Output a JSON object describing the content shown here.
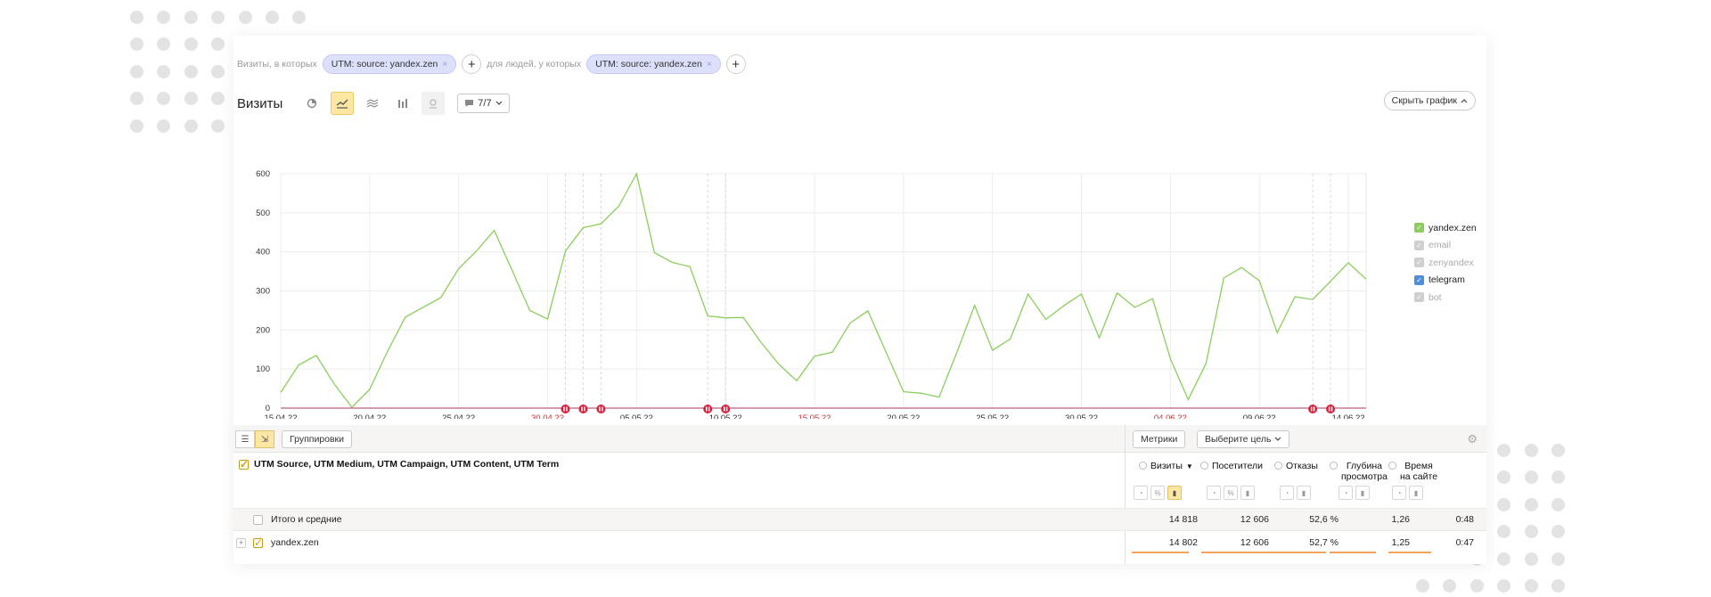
{
  "filters": {
    "visits_prefix": "Визиты, в которых",
    "visits_chip": "UTM: source: yandex.zen",
    "people_prefix": "для людей, у которых",
    "people_chip": "UTM: source: yandex.zen",
    "chip_close": "×",
    "add": "+"
  },
  "toolbar": {
    "title": "Визиты",
    "annotations_label": "7/7",
    "hide_graph": "Скрыть график"
  },
  "chart_data": {
    "type": "line",
    "ylim": [
      0,
      600
    ],
    "yticks": [
      "0",
      "100",
      "200",
      "300",
      "400",
      "500",
      "600"
    ],
    "xtick_labels": [
      {
        "label": "15.04.22",
        "weekend": false
      },
      {
        "label": "20.04.22",
        "weekend": false
      },
      {
        "label": "25.04.22",
        "weekend": false
      },
      {
        "label": "30.04.22",
        "weekend": true
      },
      {
        "label": "05.05.22",
        "weekend": false
      },
      {
        "label": "10.05.22",
        "weekend": false
      },
      {
        "label": "15.05.22",
        "weekend": true
      },
      {
        "label": "20.05.22",
        "weekend": false
      },
      {
        "label": "25.05.22",
        "weekend": false
      },
      {
        "label": "30.05.22",
        "weekend": false
      },
      {
        "label": "04.06.22",
        "weekend": true
      },
      {
        "label": "09.06.22",
        "weekend": false
      },
      {
        "label": "14.06.22",
        "weekend": false
      }
    ],
    "series": [
      {
        "name": "yandex.zen",
        "color": "#8dcd5e",
        "values": [
          40,
          110,
          135,
          62,
          2,
          48,
          145,
          233,
          258,
          283,
          357,
          402,
          455,
          353,
          250,
          228,
          402,
          462,
          472,
          517,
          600,
          398,
          373,
          362,
          236,
          231,
          232,
          168,
          112,
          70,
          133,
          143,
          218,
          249,
          145,
          42,
          38,
          28,
          143,
          263,
          148,
          177,
          292,
          227,
          262,
          292,
          180,
          295,
          258,
          280,
          126,
          22,
          114,
          333,
          360,
          326,
          193,
          285,
          278,
          325,
          372,
          330
        ]
      },
      {
        "name": "telegram",
        "color": "#4d8fdc",
        "values": [
          0,
          0,
          0,
          0,
          0,
          0,
          0,
          0,
          0,
          0,
          0,
          0,
          0,
          0,
          0,
          0,
          0,
          0,
          0,
          0,
          0,
          0,
          0,
          0,
          0,
          0,
          0,
          0,
          0,
          0,
          0,
          0,
          0,
          0,
          0,
          0,
          0,
          0,
          0,
          0,
          0,
          0,
          0,
          0,
          0,
          0,
          0,
          0,
          0,
          0,
          0,
          0,
          0,
          0,
          0,
          0,
          0,
          0,
          0,
          0,
          0,
          0
        ]
      }
    ],
    "annotation_markers": [
      16,
      17,
      18,
      24,
      25,
      58,
      59
    ]
  },
  "legend": [
    {
      "label": "yandex.zen",
      "checked": true,
      "color": "#8dcd5e",
      "text_color": "#222"
    },
    {
      "label": "email",
      "checked": true,
      "color": "#cfcfcf",
      "text_color": "#aaa"
    },
    {
      "label": "zenyandex",
      "checked": true,
      "color": "#cfcfcf",
      "text_color": "#aaa"
    },
    {
      "label": "telegram",
      "checked": true,
      "color": "#4d8fdc",
      "text_color": "#222"
    },
    {
      "label": "bot",
      "checked": true,
      "color": "#cfcfcf",
      "text_color": "#aaa"
    }
  ],
  "table": {
    "groupings_button": "Группировки",
    "metrics_button": "Метрики",
    "goal_button": "Выберите цель",
    "dimensions_header": "UTM Source, UTM Medium, UTM Campaign, UTM Content, UTM Term",
    "columns": {
      "visits": "Визиты",
      "visits_sort": "▼",
      "visitors": "Посетители",
      "bounces": "Отказы",
      "depth_line1": "Глубина",
      "depth_line2": "просмотра",
      "time_line1": "Время",
      "time_line2": "на сайте"
    },
    "totals": {
      "label": "Итого и средние",
      "visits": "14 818",
      "visitors": "12 606",
      "bounces": "52,6 %",
      "depth": "1,26",
      "time": "0:48"
    },
    "rows": [
      {
        "label": "yandex.zen",
        "visits": "14 802",
        "visitors": "12 606",
        "bounces": "52,7 %",
        "depth": "1,25",
        "time": "0:47"
      }
    ]
  },
  "accent_color": "#fde7a3"
}
